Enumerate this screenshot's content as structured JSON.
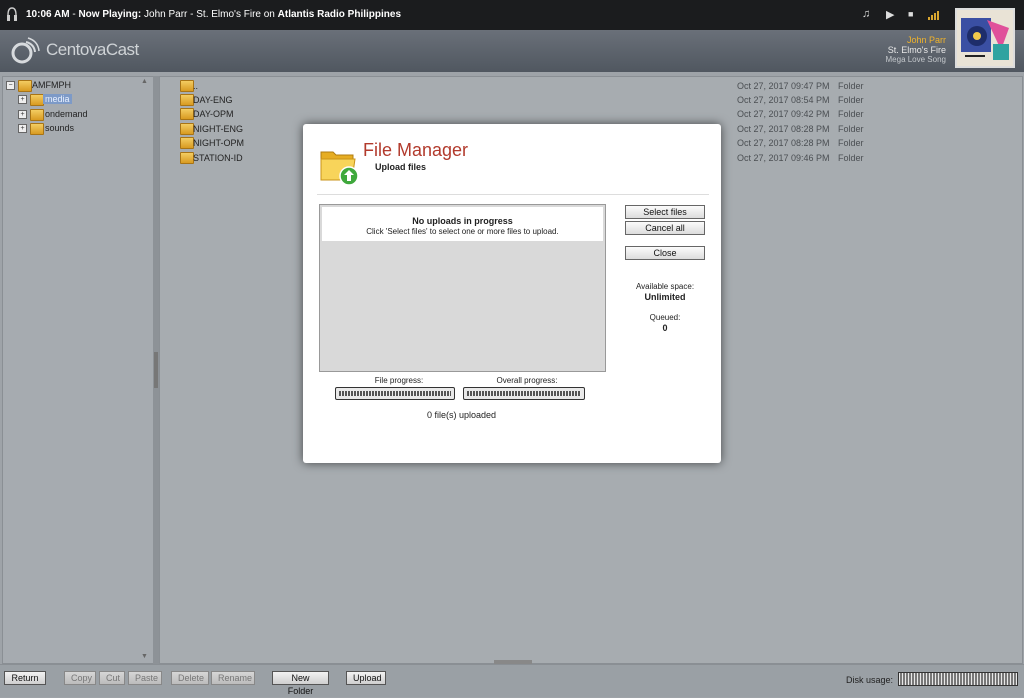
{
  "now_playing": {
    "time": "10:06 AM",
    "label": "Now Playing:",
    "track": "John Parr - St. Elmo's Fire",
    "on_word": "on",
    "station": "Atlantis Radio Philippines"
  },
  "player_controls": [
    "music-note-icon",
    "play-icon",
    "stop-icon",
    "volume-bars-icon"
  ],
  "brand": {
    "name": "CentovaCast"
  },
  "current_song": {
    "artist": "John Parr",
    "title": "St. Elmo's Fire",
    "album": "Mega Love Song"
  },
  "tree": {
    "root": "AMFMPH",
    "children": [
      {
        "label": "media",
        "selected": true
      },
      {
        "label": "ondemand",
        "selected": false
      },
      {
        "label": "sounds",
        "selected": false
      }
    ]
  },
  "files": [
    {
      "name": "..",
      "date": "Oct 27, 2017 09:47 PM",
      "type": "Folder"
    },
    {
      "name": "DAY-ENG",
      "date": "Oct 27, 2017 08:54 PM",
      "type": "Folder"
    },
    {
      "name": "DAY-OPM",
      "date": "Oct 27, 2017 09:42 PM",
      "type": "Folder"
    },
    {
      "name": "NIGHT-ENG",
      "date": "Oct 27, 2017 08:28 PM",
      "type": "Folder"
    },
    {
      "name": "NIGHT-OPM",
      "date": "Oct 27, 2017 08:28 PM",
      "type": "Folder"
    },
    {
      "name": "STATION-ID",
      "date": "Oct 27, 2017 09:46 PM",
      "type": "Folder"
    }
  ],
  "toolbar": {
    "return": "Return",
    "copy": "Copy",
    "cut": "Cut",
    "paste": "Paste",
    "delete": "Delete",
    "rename": "Rename",
    "new_folder": "New Folder",
    "upload": "Upload",
    "disk_usage_label": "Disk usage:"
  },
  "modal": {
    "title": "File Manager",
    "subtitle": "Upload files",
    "queue_heading": "No uploads in progress",
    "queue_hint": "Click 'Select files' to select one or more files to upload.",
    "select_files": "Select files",
    "cancel_all": "Cancel all",
    "close": "Close",
    "available_label": "Available space:",
    "available_value": "Unlimited",
    "queued_label": "Queued:",
    "queued_value": "0",
    "file_progress_label": "File progress:",
    "overall_progress_label": "Overall progress:",
    "uploaded_text": "0 file(s) uploaded"
  },
  "colors": {
    "title_red": "#b23a2c",
    "artist_gold": "#f0b32a",
    "selection_blue": "#7d9ac7"
  }
}
